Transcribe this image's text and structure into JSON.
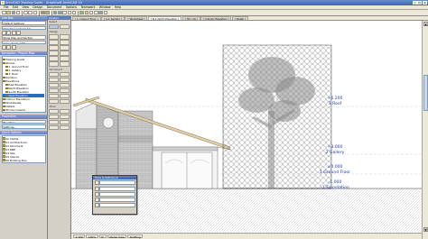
{
  "window": {
    "title": "ArchiCAD Training Guide - Graphisoft ArchiCAD 10",
    "min": "_",
    "max": "□",
    "close": "×"
  },
  "menu": [
    "File",
    "Edit",
    "View",
    "Design",
    "Document",
    "Options",
    "Teamwork",
    "Window",
    "Help"
  ],
  "tabs": [
    {
      "label": "[ 1. Ground Floor ]",
      "active": false
    },
    {
      "label": "[ S-1 Section ]",
      "active": false
    },
    {
      "label": "[ Worksheet ]",
      "active": false
    },
    {
      "label": "[ N-1 North Elevation ]",
      "active": true
    },
    {
      "label": "[ 3D / All ]",
      "active": false
    },
    {
      "label": "[ Interior Elevation ]",
      "active": false
    },
    {
      "label": "[ Detail ]",
      "active": false
    }
  ],
  "info_box": {
    "header": "Info Box",
    "fields": [
      "Default Settings",
      "Warehouse Views 10",
      "Show Plan and Section",
      "Copy, Scale 1:50"
    ]
  },
  "navigator": {
    "header": "Navigator - Project Map",
    "items": [
      {
        "label": "Training Guide",
        "selected": false
      },
      {
        "label": "Stories",
        "selected": false
      },
      {
        "label": "1. Ground Floor",
        "selected": false
      },
      {
        "label": "2. Gallery",
        "selected": false
      },
      {
        "label": "3. Roof",
        "selected": false
      },
      {
        "label": "Sections",
        "selected": false
      },
      {
        "label": "Elevations",
        "selected": false
      },
      {
        "label": "East Elevation",
        "selected": false
      },
      {
        "label": "North Elevation",
        "selected": false
      },
      {
        "label": "South Elevation",
        "selected": false
      },
      {
        "label": "West Elevation",
        "selected": true
      },
      {
        "label": "Interior Elevations",
        "selected": false
      },
      {
        "label": "Worksheets",
        "selected": false
      },
      {
        "label": "Details",
        "selected": false
      },
      {
        "label": "3D Documents",
        "selected": false
      }
    ]
  },
  "properties": {
    "header": "Properties",
    "items": [
      "Elevation",
      "Settings..."
    ]
  },
  "layers": {
    "header": "Quick Options",
    "items": [
      "All Visible",
      "01 Architectural",
      "02 Structural",
      "03 MEP",
      "04 Site",
      "05 Interior",
      "06 Building Plan"
    ]
  },
  "toolbox": {
    "header": "Toolbox",
    "section_labels": [
      "Select",
      "Design",
      "Document",
      "More"
    ]
  },
  "levels": [
    {
      "elevation": "+6.200",
      "name": "3 Roof"
    },
    {
      "elevation": "+3.000",
      "name": "2 Gallery"
    },
    {
      "elevation": "±0.000",
      "name": "1 Ground Floor"
    },
    {
      "elevation": "-1.000",
      "name": "-1 Foundation"
    }
  ],
  "dialog": {
    "title": "Trace & Reference"
  },
  "status": [
    "1:100",
    "100%",
    "0°",
    "Model View",
    "Drafting"
  ],
  "colors": {
    "level_text": "#1f3fb0",
    "accent": "#3e63a8",
    "selection": "#316ac5"
  }
}
